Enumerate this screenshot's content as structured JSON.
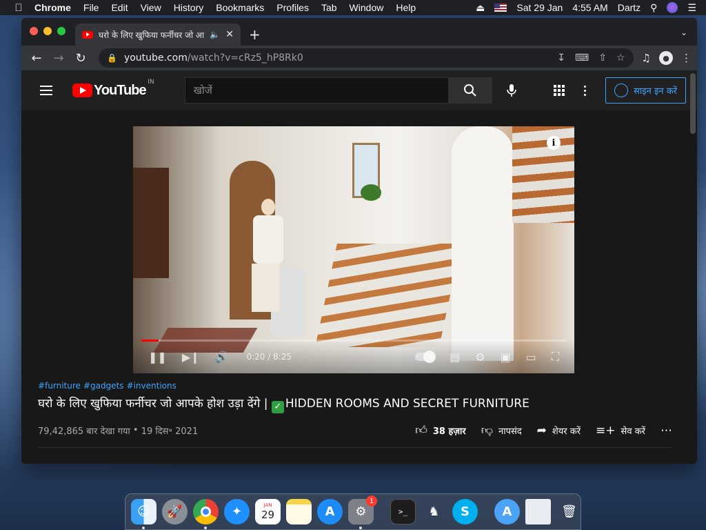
{
  "menubar": {
    "app": "Chrome",
    "items": [
      "File",
      "Edit",
      "View",
      "History",
      "Bookmarks",
      "Profiles",
      "Tab",
      "Window",
      "Help"
    ],
    "date": "Sat 29 Jan",
    "time": "4:55 AM",
    "user": "Dartz"
  },
  "browser": {
    "tab_title": "घरो के लिए खुफिया फर्नीचर जो आ",
    "url_host": "youtube.com",
    "url_path": "/watch?v=cRz5_hP8Rk0"
  },
  "youtube": {
    "logo_text": "YouTube",
    "region": "IN",
    "search_placeholder": "खोजें",
    "signin_label": "साइन इन करें",
    "video": {
      "progress": 0.04,
      "current_time": "0:20",
      "duration": "8:25",
      "hashtags": [
        "#furniture",
        "#gadgets",
        "#inventions"
      ],
      "title_hindi": "घरो के लिए खुफिया फर्नीचर जो आपके होश उड़ा देंगे |",
      "title_check": "✓",
      "title_english": "HIDDEN ROOMS AND SECRET FURNITURE",
      "views": "79,42,865 बार देखा गया",
      "date": "19 दिस॰ 2021",
      "likes": "38 हज़ार",
      "dislike_label": "नापसंद",
      "share_label": "शेयर करें",
      "save_label": "सेव करें"
    }
  },
  "dock": {
    "items": [
      "Finder",
      "Launchpad",
      "Chrome",
      "Safari",
      "Calendar",
      "Notes",
      "App Store",
      "System Preferences",
      "Terminal",
      "Chess",
      "Skype",
      "App Store Downloads",
      "Document",
      "Trash"
    ],
    "calendar_day": "29",
    "calendar_month": "JAN",
    "prefs_badge": "1"
  },
  "colors": {
    "yt_red": "#ff0000",
    "link_blue": "#3ea6ff",
    "page_bg": "#181818"
  }
}
